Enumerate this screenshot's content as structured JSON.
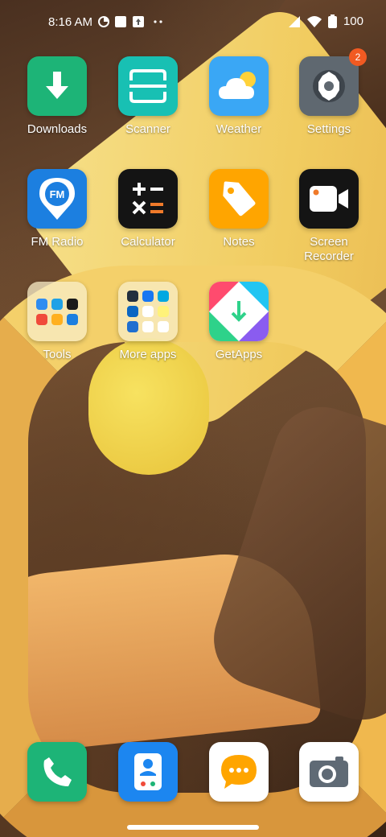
{
  "status": {
    "time": "8:16 AM",
    "battery": "100",
    "icons": [
      "notification-icon-1",
      "notification-icon-2",
      "notification-icon-3",
      "more-dots-icon",
      "signal-icon",
      "wifi-icon",
      "battery-icon"
    ]
  },
  "apps": {
    "downloads": {
      "label": "Downloads",
      "icon": "download-arrow-icon",
      "color": "#1db477"
    },
    "scanner": {
      "label": "Scanner",
      "icon": "scan-frame-icon",
      "color": "#18c0b3"
    },
    "weather": {
      "label": "Weather",
      "icon": "cloud-sun-icon",
      "color": "#3aa7f5"
    },
    "settings": {
      "label": "Settings",
      "icon": "gear-icon",
      "color": "#5f6870",
      "badge": "2"
    },
    "fm_radio": {
      "label": "FM Radio",
      "icon": "fm-pin-icon",
      "color": "#1c7fe0",
      "glyph": "FM"
    },
    "calculator": {
      "label": "Calculator",
      "icon": "calculator-icon",
      "color": "#141414"
    },
    "notes": {
      "label": "Notes",
      "icon": "tag-icon",
      "color": "#ffa500"
    },
    "screen_recorder": {
      "label": "Screen\nRecorder",
      "icon": "video-camera-icon",
      "color": "#141414"
    },
    "tools": {
      "label": "Tools",
      "icon": "folder-icon"
    },
    "more_apps": {
      "label": "More apps",
      "icon": "folder-icon"
    },
    "getapps": {
      "label": "GetApps",
      "icon": "getapps-icon"
    }
  },
  "dock": [
    {
      "name": "phone",
      "icon": "phone-icon",
      "color": "#1db477"
    },
    {
      "name": "contacts",
      "icon": "contacts-icon",
      "color": "#1c86f0"
    },
    {
      "name": "messages",
      "icon": "chat-bubble-icon",
      "color": "#ffffff"
    },
    {
      "name": "camera",
      "icon": "camera-icon",
      "color": "#ffffff"
    }
  ]
}
